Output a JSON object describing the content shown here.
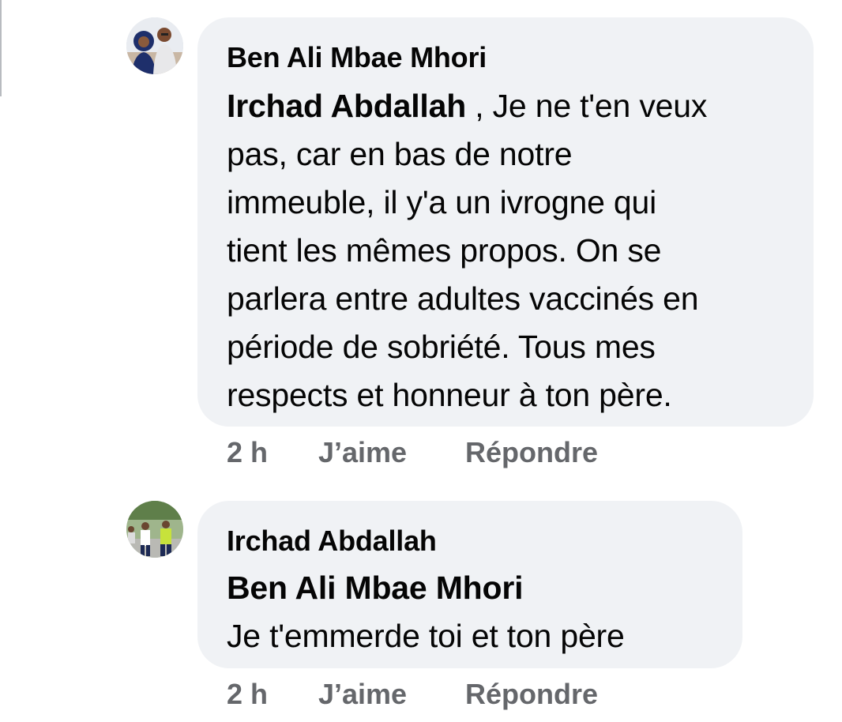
{
  "comments": [
    {
      "author": "Ben Ali Mbae Mhori",
      "mention": "Irchad Abdallah",
      "text_lines": [
        " , Je ne  t'en veux",
        "pas, car en bas de notre",
        "immeuble,  il y'a un ivrogne qui",
        "tient les mêmes propos. On se",
        "parlera entre adultes vaccinés en",
        "période de sobriété.  Tous mes",
        "respects et honneur à ton père."
      ],
      "time": "2 h",
      "like_label": "J’aime",
      "reply_label": "Répondre"
    },
    {
      "author": "Irchad Abdallah",
      "mention": "Ben Ali Mbae Mhori",
      "text_lines": [
        "Je t'emmerde toi et ton père"
      ],
      "time": "2 h",
      "like_label": "J’aime",
      "reply_label": "Répondre"
    }
  ],
  "colors": {
    "bubble_bg": "#f0f2f5",
    "meta_text": "#65676b",
    "text": "#050505"
  }
}
